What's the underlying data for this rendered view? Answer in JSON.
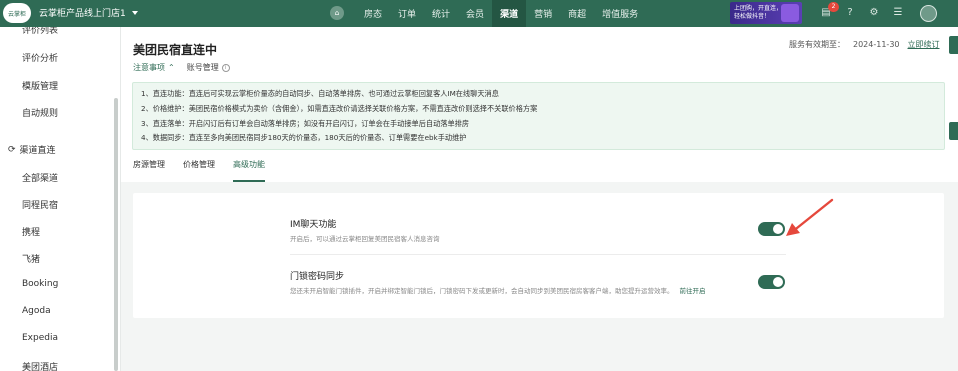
{
  "topbar": {
    "logo_text": "云掌柜",
    "store_name": "云掌柜产品线上门店1",
    "nav": [
      {
        "label": "房态",
        "active": false
      },
      {
        "label": "订单",
        "active": false
      },
      {
        "label": "统计",
        "active": false
      },
      {
        "label": "会员",
        "active": false
      },
      {
        "label": "渠道",
        "active": true
      },
      {
        "label": "营销",
        "active": false
      },
      {
        "label": "商超",
        "active": false
      },
      {
        "label": "增值服务",
        "active": false
      }
    ],
    "promo_line1": "上团购，开直连，",
    "promo_line2": "轻松做抖音！",
    "message_count": "2",
    "icons": [
      "message-icon",
      "help-icon",
      "gear-icon",
      "menu-icon",
      "avatar"
    ]
  },
  "sidebar": {
    "items": [
      {
        "label": "评价列表",
        "type": "item"
      },
      {
        "label": "评价分析",
        "type": "item"
      },
      {
        "label": "模版管理",
        "type": "item"
      },
      {
        "label": "自动规则",
        "type": "item"
      },
      {
        "label": "渠道直连",
        "type": "group"
      },
      {
        "label": "全部渠道",
        "type": "item"
      },
      {
        "label": "同程民宿",
        "type": "item"
      },
      {
        "label": "携程",
        "type": "item"
      },
      {
        "label": "飞猪",
        "type": "item"
      },
      {
        "label": "Booking",
        "type": "item"
      },
      {
        "label": "Agoda",
        "type": "item"
      },
      {
        "label": "Expedia",
        "type": "item"
      },
      {
        "label": "美团酒店",
        "type": "item"
      }
    ]
  },
  "header": {
    "title": "美团民宿直连中",
    "expiry_label": "服务有效期至：",
    "expiry_date": "2024-11-30",
    "renew_label": "立即续订",
    "notice_label": "注意事项",
    "account_label": "账号管理",
    "notices": [
      "1、直连功能：直连后可实现云掌柜价量态的自动同步、自动落单排房、也可通过云掌柜回复客人IM在线聊天消息",
      "2、价格维护：美团民宿价格模式为卖价（含佣金），如需直连改价请选择关联价格方案，不需直连改价则选择不关联价格方案",
      "3、直连落单：开启闪订后有订单会自动落单排房；如没有开启闪订，订单会在手动接单后自动落单排房",
      "4、数据同步：直连至多向美团民宿同步180天的价量态，180天后的价量态、订单需要在ebk手动维护"
    ],
    "tabs": [
      {
        "label": "房源管理",
        "active": false
      },
      {
        "label": "价格管理",
        "active": false
      },
      {
        "label": "高级功能",
        "active": true
      }
    ]
  },
  "features": [
    {
      "title": "IM聊天功能",
      "desc": "开启后，可以通过云掌柜回复美团民宿客人消息咨询",
      "link": "",
      "enabled": true
    },
    {
      "title": "门锁密码同步",
      "desc": "您还未开启智能门锁插件，开启并绑定智能门锁后，门锁密码下发或更新时，会自动同步到美团民宿房客客户端，助您提升运营效率。",
      "link": "前往开启",
      "enabled": true
    }
  ],
  "colors": {
    "brand": "#2f6b55",
    "arrow": "#e5483c",
    "notice_bg": "#eef7f1"
  }
}
